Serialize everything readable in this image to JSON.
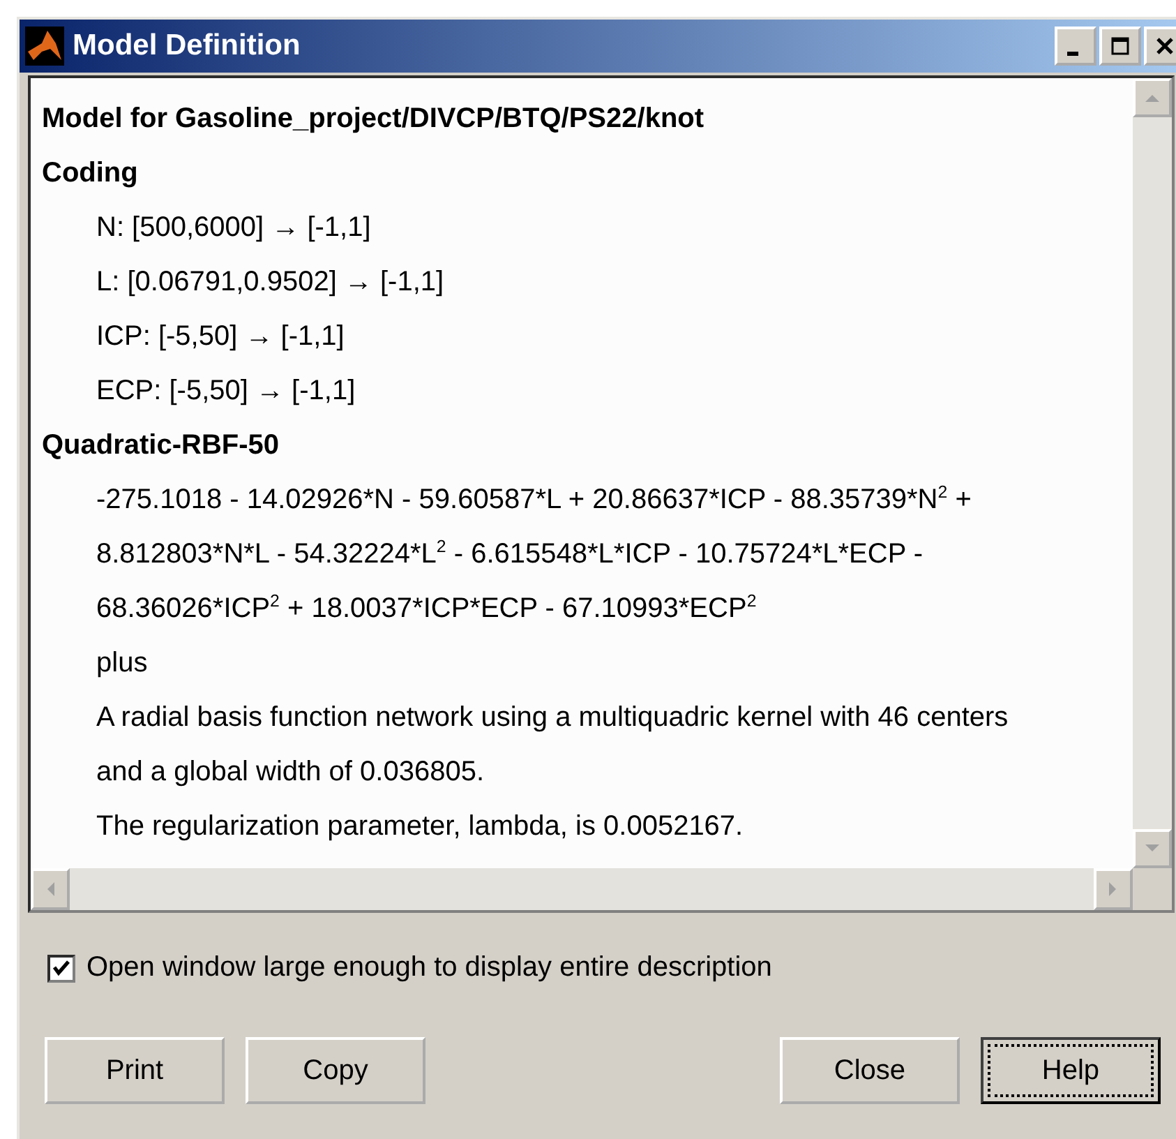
{
  "window": {
    "title": "Model Definition"
  },
  "description": [
    {
      "kind": "heading",
      "text": "Model for Gasoline_project/DIVCP/BTQ/PS22/knot"
    },
    {
      "kind": "heading",
      "text": "Coding"
    },
    {
      "kind": "line",
      "text": "N: [500,6000] → [-1,1]"
    },
    {
      "kind": "line",
      "text": "L: [0.06791,0.9502] → [-1,1]"
    },
    {
      "kind": "line",
      "text": "ICP: [-5,50] → [-1,1]"
    },
    {
      "kind": "line",
      "text": "ECP: [-5,50] → [-1,1]"
    },
    {
      "kind": "heading",
      "text": "Quadratic-RBF-50"
    },
    {
      "kind": "line",
      "text": "-275.1018 - 14.02926*N - 59.60587*L + 20.86637*ICP - 88.35739*N$^{2}$ +"
    },
    {
      "kind": "line",
      "text": "8.812803*N*L - 54.32224*L$^{2}$ - 6.615548*L*ICP - 10.75724*L*ECP -"
    },
    {
      "kind": "line",
      "text": "68.36026*ICP$^{2}$ + 18.0037*ICP*ECP - 67.10993*ECP$^{2}$"
    },
    {
      "kind": "line",
      "text": "plus"
    },
    {
      "kind": "line",
      "text": "A radial basis function network using a multiquadric kernel with 46 centers"
    },
    {
      "kind": "line",
      "text": "and a global width of 0.036805."
    },
    {
      "kind": "line",
      "text": "The regularization parameter, lambda, is 0.0052167."
    }
  ],
  "option": {
    "label": "Open window large enough to display entire description",
    "checked": true
  },
  "buttons": [
    {
      "label": "Print",
      "focused": false
    },
    {
      "label": "Copy",
      "focused": false
    },
    {
      "label": "Close",
      "focused": false
    },
    {
      "label": "Help",
      "focused": true
    }
  ]
}
